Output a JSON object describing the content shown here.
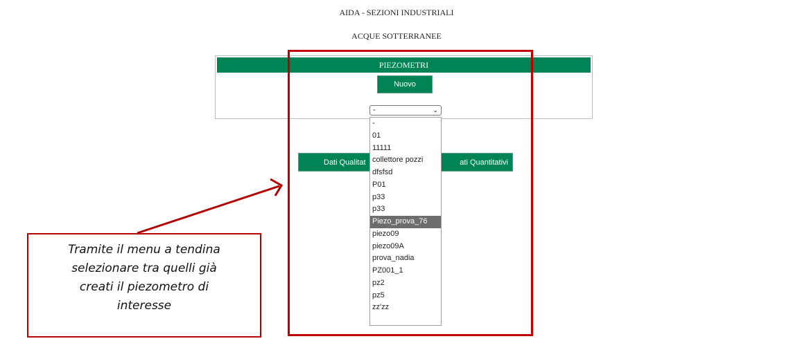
{
  "header": {
    "title": "AIDA - SEZIONI INDUSTRIALI",
    "subtitle": "ACQUE SOTTERRANEE"
  },
  "panel": {
    "title": "PIEZOMETRI",
    "new_button": "Nuovo",
    "select_value": "-"
  },
  "actions": {
    "qualitative_visible": "Dati Qualitat",
    "quantitative_visible": "ati Quantitativi"
  },
  "dropdown": {
    "selected": "Piezo_prova_76",
    "options": [
      "-",
      "01",
      "11111",
      "collettore pozzi",
      "dfsfsd",
      "P01",
      "p33",
      "p33",
      "Piezo_prova_76",
      "piezo09",
      "piezo09A",
      "prova_nadia",
      "PZ001_1",
      "pz2",
      "pz5",
      "zz'zz"
    ]
  },
  "annotation": {
    "lines": [
      "Tramite il menu a tendina",
      "selezionare tra quelli già",
      "creati il piezometro di",
      "interesse"
    ],
    "color": "#c00000"
  },
  "colors": {
    "accent": "#008456",
    "highlight": "#c00000"
  }
}
